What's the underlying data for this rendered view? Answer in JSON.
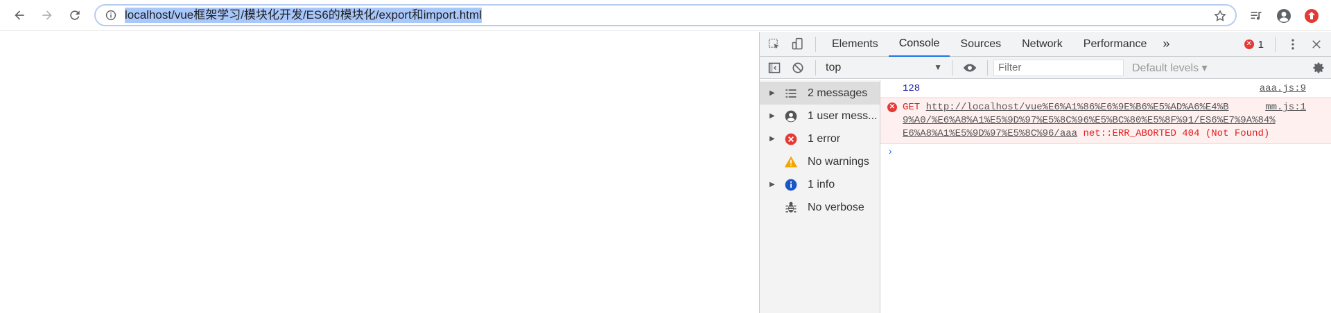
{
  "browser": {
    "url": "localhost/vue框架学习/模块化开发/ES6的模块化/export和import.html"
  },
  "devtools": {
    "tabs": [
      "Elements",
      "Console",
      "Sources",
      "Network",
      "Performance"
    ],
    "more": "»",
    "error_count": "1",
    "context": "top",
    "filter_placeholder": "Filter",
    "levels": "Default levels ▾",
    "sidebar": [
      {
        "label": "2 messages",
        "icon": "list-icon",
        "expand": true,
        "selected": true
      },
      {
        "label": "1 user mess...",
        "icon": "user-icon",
        "expand": true,
        "selected": false
      },
      {
        "label": "1 error",
        "icon": "error-icon",
        "expand": true,
        "selected": false
      },
      {
        "label": "No warnings",
        "icon": "warning-icon",
        "expand": false,
        "selected": false
      },
      {
        "label": "1 info",
        "icon": "info-icon",
        "expand": true,
        "selected": false
      },
      {
        "label": "No verbose",
        "icon": "bug-icon",
        "expand": false,
        "selected": false
      }
    ],
    "messages": {
      "log_value": "128",
      "log_source": "aaa.js:9",
      "error_method": "GET",
      "error_url_line1": "http://localhost/vue%E6%A1%86%E6%9E%B6%E5%AD%A6%E4%B",
      "error_url_line2": "9%A0/%E6%A8%A1%E5%9D%97%E5%8C%96%E5%BC%80%E5%8F%91/ES6%E7%9A%84%",
      "error_url_line3": "E6%A8%A1%E5%9D%97%E5%8C%96/aaa",
      "error_status": "net::ERR_ABORTED 404 (Not Found)",
      "error_source": "mm.js:1"
    },
    "prompt": "›"
  },
  "colors": {
    "error": "#e53935",
    "accent": "#1a73e8",
    "url_highlight": "#a8c7fa"
  }
}
